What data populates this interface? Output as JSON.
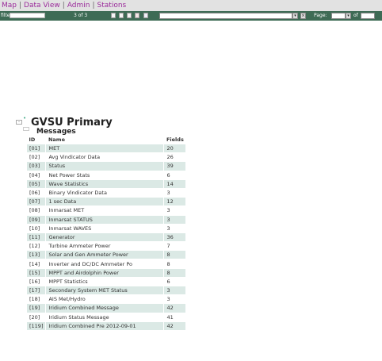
{
  "nav": {
    "links": [
      "Map",
      "Data View",
      "Admin",
      "Stations"
    ],
    "separator": "|"
  },
  "toolbar": {
    "filter_label": "filter",
    "filter_value": "",
    "record_count": "3 of 3",
    "page_label": "Page:",
    "of_label": "of"
  },
  "tree": {
    "station": "GVSU Primary",
    "section": "Messages"
  },
  "table": {
    "headers": [
      "ID",
      "Name",
      "Fields"
    ],
    "rows": [
      {
        "id": "[01]",
        "name": "MET",
        "fields": "20"
      },
      {
        "id": "[02]",
        "name": "Avg Vindicator Data",
        "fields": "26"
      },
      {
        "id": "[03]",
        "name": "Status",
        "fields": "39"
      },
      {
        "id": "[04]",
        "name": "Net Power Stats",
        "fields": "6"
      },
      {
        "id": "[05]",
        "name": "Wave Statistics",
        "fields": "14"
      },
      {
        "id": "[06]",
        "name": "Binary Vindicator Data",
        "fields": "3"
      },
      {
        "id": "[07]",
        "name": "1 sec Data",
        "fields": "12"
      },
      {
        "id": "[08]",
        "name": "Inmarsat MET",
        "fields": "3"
      },
      {
        "id": "[09]",
        "name": "Inmarsat STATUS",
        "fields": "3"
      },
      {
        "id": "[10]",
        "name": "Inmarsat WAVES",
        "fields": "3"
      },
      {
        "id": "[11]",
        "name": "Generator",
        "fields": "36"
      },
      {
        "id": "[12]",
        "name": "Turbine Ammeter Power",
        "fields": "7"
      },
      {
        "id": "[13]",
        "name": "Solar and Gen Ammeter Power",
        "fields": "8"
      },
      {
        "id": "[14]",
        "name": "Inverter and DC/DC Ammeter Po",
        "fields": "8"
      },
      {
        "id": "[15]",
        "name": "MPPT and Airdolphin Power",
        "fields": "8"
      },
      {
        "id": "[16]",
        "name": "MPPT Statistics",
        "fields": "6"
      },
      {
        "id": "[17]",
        "name": "Secondary System MET Status",
        "fields": "3"
      },
      {
        "id": "[18]",
        "name": "AIS Met/Hydro",
        "fields": "3"
      },
      {
        "id": "[19]",
        "name": "Iridium Combined Message",
        "fields": "42"
      },
      {
        "id": "[20]",
        "name": "Iridium Status Message",
        "fields": "41"
      },
      {
        "id": "[119]",
        "name": "Iridium Combined Pre 2012-09-01",
        "fields": "42"
      }
    ]
  },
  "colors": {
    "toolbar_bg": "#3e6b55",
    "nav_link": "#9a2a9a",
    "row_stripe": "#dbe9e5"
  }
}
